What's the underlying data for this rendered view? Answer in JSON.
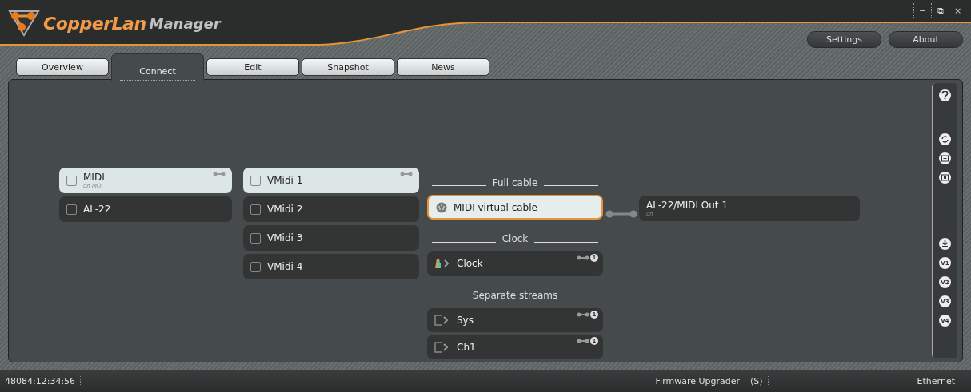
{
  "window": {
    "brand": "CopperLan",
    "product": "Manager",
    "controls": [
      "−",
      "⧉",
      "×"
    ]
  },
  "header_buttons": [
    "Settings",
    "About"
  ],
  "tabs": [
    {
      "label": "Overview",
      "selected": false
    },
    {
      "label": "Connect",
      "selected": true
    },
    {
      "label": "Edit",
      "selected": false
    },
    {
      "label": "Snapshot",
      "selected": false
    },
    {
      "label": "News",
      "selected": false
    }
  ],
  "devices": [
    {
      "name": "MIDI",
      "subtitle": "on MOI",
      "selected": true,
      "checked": false
    },
    {
      "name": "AL-22",
      "selected": false,
      "checked": false
    }
  ],
  "ports": [
    {
      "name": "VMidi 1",
      "selected": true,
      "checked": false
    },
    {
      "name": "VMidi 2",
      "selected": false,
      "checked": false
    },
    {
      "name": "VMidi 3",
      "selected": false,
      "checked": false
    },
    {
      "name": "VMidi 4",
      "selected": false,
      "checked": false
    }
  ],
  "streams": [
    {
      "title": "Full cable",
      "items": [
        {
          "kind": "cable",
          "name": "MIDI virtual cable",
          "selected": true
        }
      ]
    },
    {
      "title": "Clock",
      "items": [
        {
          "kind": "clock",
          "name": "Clock",
          "selected": false,
          "badge": "1"
        }
      ]
    },
    {
      "title": "Separate streams",
      "items": [
        {
          "kind": "stream",
          "name": "Sys",
          "selected": false,
          "badge": "1"
        },
        {
          "kind": "stream",
          "name": "Ch1",
          "selected": false,
          "badge": "1"
        }
      ]
    }
  ],
  "destinations": [
    {
      "name": "AL-22/MIDI Out 1",
      "subtitle": "on",
      "connected": true
    }
  ],
  "sidebar": {
    "groups": [
      {
        "items": [
          {
            "kind": "help"
          }
        ]
      },
      {
        "items": [
          {
            "kind": "refresh"
          },
          {
            "kind": "add"
          },
          {
            "kind": "view"
          }
        ]
      },
      {
        "items": [
          {
            "kind": "download"
          },
          {
            "kind": "preset",
            "label": "V1"
          },
          {
            "kind": "preset",
            "label": "V2"
          },
          {
            "kind": "preset",
            "label": "V3"
          },
          {
            "kind": "preset",
            "label": "V4"
          }
        ]
      }
    ]
  },
  "status_bar": {
    "left": "48084:12:34:56",
    "items": [
      "Firmware Upgrader",
      "(S)"
    ],
    "right": "Ethernet"
  }
}
